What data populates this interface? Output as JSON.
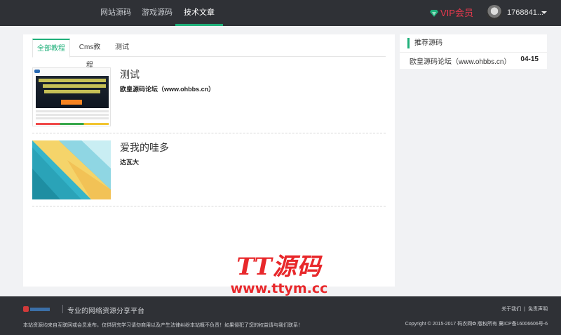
{
  "nav": {
    "items": [
      {
        "label": "网站源码",
        "active": false
      },
      {
        "label": "游戏源码",
        "active": false
      },
      {
        "label": "技术文章",
        "active": true
      }
    ],
    "vip_label": "VIP会员",
    "username": "1768841...",
    "accent_color": "#1fb07a",
    "vip_color": "#e8394e"
  },
  "tabs": [
    {
      "label": "全部教程",
      "active": true
    },
    {
      "label": "Cms教程",
      "active": false
    },
    {
      "label": "测试",
      "active": false
    }
  ],
  "articles": [
    {
      "title": "测试",
      "author": "欧皇源码论坛（www.ohbbs.cn）",
      "thumb_icon": "website-screenshot-thumbnail"
    },
    {
      "title": "爱我的哇多",
      "author": "达瓦大",
      "thumb_icon": "material-geometric-thumbnail"
    }
  ],
  "sidebar": {
    "heading": "推荐源码",
    "items": [
      {
        "label": "欧皇源码论坛（www.ohbbs.cn）",
        "date": "04-15"
      }
    ]
  },
  "watermark": {
    "title": "TT源码",
    "url": "www.ttym.cc"
  },
  "footer": {
    "slogan": "专业的网络资源分享平台",
    "notice": "本站资源均来自互联网或会员发布，仅供研究学习请勿商用以及产生法律纠纷本站概不负责！如果侵犯了您的权益请与我们联系！",
    "links": [
      "关于我们",
      "|",
      "免责声明"
    ],
    "copyright": "Copyright © 2015-2017 码农网✿ 版权所有 冀ICP备16006606号-6"
  }
}
